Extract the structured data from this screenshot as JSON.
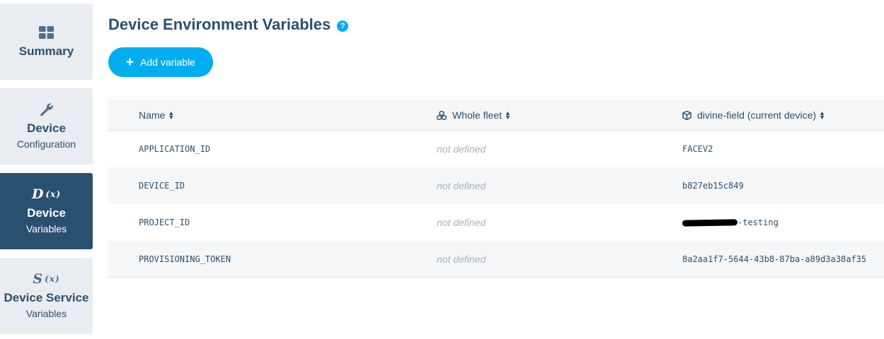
{
  "sidebar": {
    "items": [
      {
        "title": "Summary",
        "subtitle": ""
      },
      {
        "title": "Device",
        "subtitle": "Configuration"
      },
      {
        "title": "Device",
        "subtitle": "Variables",
        "glyph": "D",
        "glyph_sub": "(x)",
        "active": true
      },
      {
        "title": "Device Service",
        "subtitle": "Variables",
        "glyph": "S",
        "glyph_sub": "(x)"
      }
    ]
  },
  "page": {
    "title": "Device Environment Variables",
    "help_icon": "?"
  },
  "toolbar": {
    "add_label": "Add variable"
  },
  "table": {
    "columns": [
      {
        "label": "Name",
        "icon": ""
      },
      {
        "label": "Whole fleet",
        "icon": "cubes-icon"
      },
      {
        "label": "divine-field (current device)",
        "icon": "cube-icon"
      }
    ],
    "rows": [
      {
        "name": "APPLICATION_ID",
        "fleet": "not defined",
        "device": "FACEV2"
      },
      {
        "name": "DEVICE_ID",
        "fleet": "not defined",
        "device": "b827eb15c849"
      },
      {
        "name": "PROJECT_ID",
        "fleet": "not defined",
        "device": "-testing",
        "redacted": true
      },
      {
        "name": "PROVISIONING_TOKEN",
        "fleet": "not defined",
        "device": "8a2aa1f7-5644-43b8-87ba-a89d3a38af35"
      }
    ]
  },
  "colors": {
    "accent": "#00aeef",
    "navy": "#2a506f",
    "tile_bg": "#e9ecf0",
    "row_alt": "#f4f6f8"
  }
}
